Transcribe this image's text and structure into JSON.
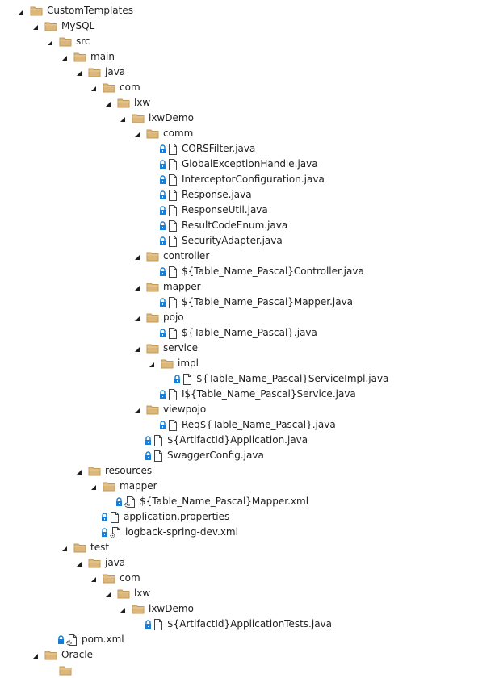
{
  "tree": [
    {
      "name": "CustomTemplates",
      "type": "folder",
      "depth": 0,
      "expanded": true
    },
    {
      "name": "MySQL",
      "type": "folder",
      "depth": 1,
      "expanded": true
    },
    {
      "name": "src",
      "type": "folder",
      "depth": 2,
      "expanded": true
    },
    {
      "name": "main",
      "type": "folder",
      "depth": 3,
      "expanded": true
    },
    {
      "name": "java",
      "type": "folder",
      "depth": 4,
      "expanded": true
    },
    {
      "name": "com",
      "type": "folder",
      "depth": 5,
      "expanded": true
    },
    {
      "name": "lxw",
      "type": "folder",
      "depth": 6,
      "expanded": true
    },
    {
      "name": "lxwDemo",
      "type": "folder",
      "depth": 7,
      "expanded": true
    },
    {
      "name": "comm",
      "type": "folder",
      "depth": 8,
      "expanded": true
    },
    {
      "name": "CORSFilter.java",
      "type": "file",
      "depth": 9,
      "locked": true
    },
    {
      "name": "GlobalExceptionHandle.java",
      "type": "file",
      "depth": 9,
      "locked": true
    },
    {
      "name": "InterceptorConfiguration.java",
      "type": "file",
      "depth": 9,
      "locked": true
    },
    {
      "name": "Response.java",
      "type": "file",
      "depth": 9,
      "locked": true
    },
    {
      "name": "ResponseUtil.java",
      "type": "file",
      "depth": 9,
      "locked": true
    },
    {
      "name": "ResultCodeEnum.java",
      "type": "file",
      "depth": 9,
      "locked": true
    },
    {
      "name": "SecurityAdapter.java",
      "type": "file",
      "depth": 9,
      "locked": true
    },
    {
      "name": "controller",
      "type": "folder",
      "depth": 8,
      "expanded": true
    },
    {
      "name": "${Table_Name_Pascal}Controller.java",
      "type": "file",
      "depth": 9,
      "locked": true
    },
    {
      "name": "mapper",
      "type": "folder",
      "depth": 8,
      "expanded": true
    },
    {
      "name": "${Table_Name_Pascal}Mapper.java",
      "type": "file",
      "depth": 9,
      "locked": true
    },
    {
      "name": "pojo",
      "type": "folder",
      "depth": 8,
      "expanded": true
    },
    {
      "name": "${Table_Name_Pascal}.java",
      "type": "file",
      "depth": 9,
      "locked": true
    },
    {
      "name": "service",
      "type": "folder",
      "depth": 8,
      "expanded": true
    },
    {
      "name": "impl",
      "type": "folder",
      "depth": 9,
      "expanded": true
    },
    {
      "name": "${Table_Name_Pascal}ServiceImpl.java",
      "type": "file",
      "depth": 10,
      "locked": true
    },
    {
      "name": "I${Table_Name_Pascal}Service.java",
      "type": "file",
      "depth": 9,
      "locked": true
    },
    {
      "name": "viewpojo",
      "type": "folder",
      "depth": 8,
      "expanded": true
    },
    {
      "name": "Req${Table_Name_Pascal}.java",
      "type": "file",
      "depth": 9,
      "locked": true
    },
    {
      "name": "${ArtifactId}Application.java",
      "type": "file",
      "depth": 8,
      "locked": true
    },
    {
      "name": "SwaggerConfig.java",
      "type": "file",
      "depth": 8,
      "locked": true
    },
    {
      "name": "resources",
      "type": "folder",
      "depth": 4,
      "expanded": true
    },
    {
      "name": "mapper",
      "type": "folder",
      "depth": 5,
      "expanded": true
    },
    {
      "name": "${Table_Name_Pascal}Mapper.xml",
      "type": "config",
      "depth": 6,
      "locked": true
    },
    {
      "name": "application.properties",
      "type": "file",
      "depth": 5,
      "locked": true
    },
    {
      "name": "logback-spring-dev.xml",
      "type": "config",
      "depth": 5,
      "locked": true
    },
    {
      "name": "test",
      "type": "folder",
      "depth": 3,
      "expanded": true
    },
    {
      "name": "java",
      "type": "folder",
      "depth": 4,
      "expanded": true
    },
    {
      "name": "com",
      "type": "folder",
      "depth": 5,
      "expanded": true
    },
    {
      "name": "lxw",
      "type": "folder",
      "depth": 6,
      "expanded": true
    },
    {
      "name": "lxwDemo",
      "type": "folder",
      "depth": 7,
      "expanded": true
    },
    {
      "name": "${ArtifactId}ApplicationTests.java",
      "type": "file",
      "depth": 8,
      "locked": true
    },
    {
      "name": "pom.xml",
      "type": "config",
      "depth": 2,
      "locked": true
    },
    {
      "name": "Oracle",
      "type": "folder",
      "depth": 1,
      "expanded": true
    },
    {
      "name": "",
      "type": "folder",
      "depth": 2,
      "expanded": false
    }
  ],
  "colors": {
    "folder_fill": "#dcb67a",
    "folder_stroke": "#c19a57",
    "lock": "#1a7fd4",
    "file_stroke": "#424242",
    "arrow": "#1e1e1e"
  }
}
